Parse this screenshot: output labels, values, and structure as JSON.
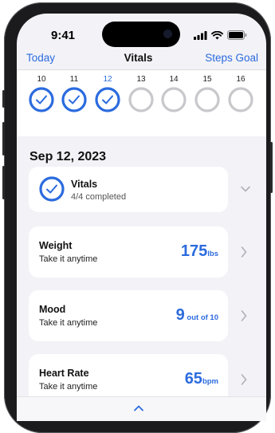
{
  "status_bar": {
    "time": "9:41"
  },
  "nav": {
    "left": "Today",
    "title": "Vitals",
    "right": "Steps Goal"
  },
  "days": [
    {
      "num": "10",
      "state": "done"
    },
    {
      "num": "11",
      "state": "done"
    },
    {
      "num": "12",
      "state": "selected"
    },
    {
      "num": "13",
      "state": "empty"
    },
    {
      "num": "14",
      "state": "empty"
    },
    {
      "num": "15",
      "state": "empty"
    },
    {
      "num": "16",
      "state": "empty"
    }
  ],
  "date_heading": "Sep 12, 2023",
  "summary": {
    "title": "Vitals",
    "subtitle": "4/4 completed"
  },
  "metrics": [
    {
      "title": "Weight",
      "subtitle": "Take it anytime",
      "value": "175",
      "unit": "lbs"
    },
    {
      "title": "Mood",
      "subtitle": "Take it anytime",
      "value": "9",
      "unit": " out of 10"
    },
    {
      "title": "Heart Rate",
      "subtitle": "Take it anytime",
      "value": "65",
      "unit": "bpm"
    }
  ],
  "colors": {
    "accent": "#2b6bde",
    "ring_empty": "#c8c8cc",
    "background": "#f2f2f7",
    "card": "#ffffff"
  },
  "icons": {
    "check": "checkmark-icon",
    "chevron_right": "chevron-right-icon",
    "chevron_down": "chevron-down-icon",
    "chevron_up": "chevron-up-icon"
  }
}
